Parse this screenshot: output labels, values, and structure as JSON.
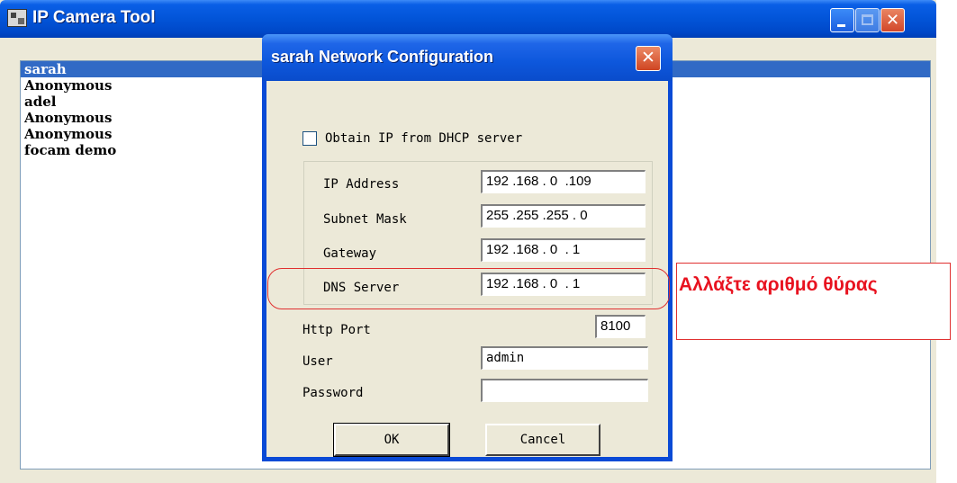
{
  "window": {
    "title": "IP Camera Tool",
    "close_glyph": "✕"
  },
  "camera_list": {
    "items": [
      "sarah",
      "Anonymous",
      "adel",
      "Anonymous",
      "Anonymous",
      "focam demo"
    ],
    "selected": "sarah"
  },
  "dialog": {
    "title": "sarah Network Configuration",
    "close_glyph": "✕",
    "dhcp_label": "Obtain IP from DHCP server",
    "dhcp_checked": false,
    "ip_label": "IP Address",
    "ip_value": "192 .168 . 0  .109",
    "subnet_label": "Subnet Mask",
    "subnet_value": "255 .255 .255 . 0",
    "gateway_label": "Gateway",
    "gateway_value": "192 .168 . 0  . 1",
    "dns_label": "DNS Server",
    "dns_value": "192 .168 . 0  . 1",
    "http_port_label": "Http Port",
    "http_port_value": "8100",
    "user_label": "User",
    "user_value": "admin",
    "password_label": "Password",
    "password_value": "",
    "ok_label": "OK",
    "cancel_label": "Cancel"
  },
  "annotation": {
    "text": "Αλλάξτε αριθμό θύρας",
    "color": "#e8121f"
  },
  "colors": {
    "titlebar_blue": "#0254d8",
    "selection": "#316ac5",
    "face": "#ece9d8"
  }
}
